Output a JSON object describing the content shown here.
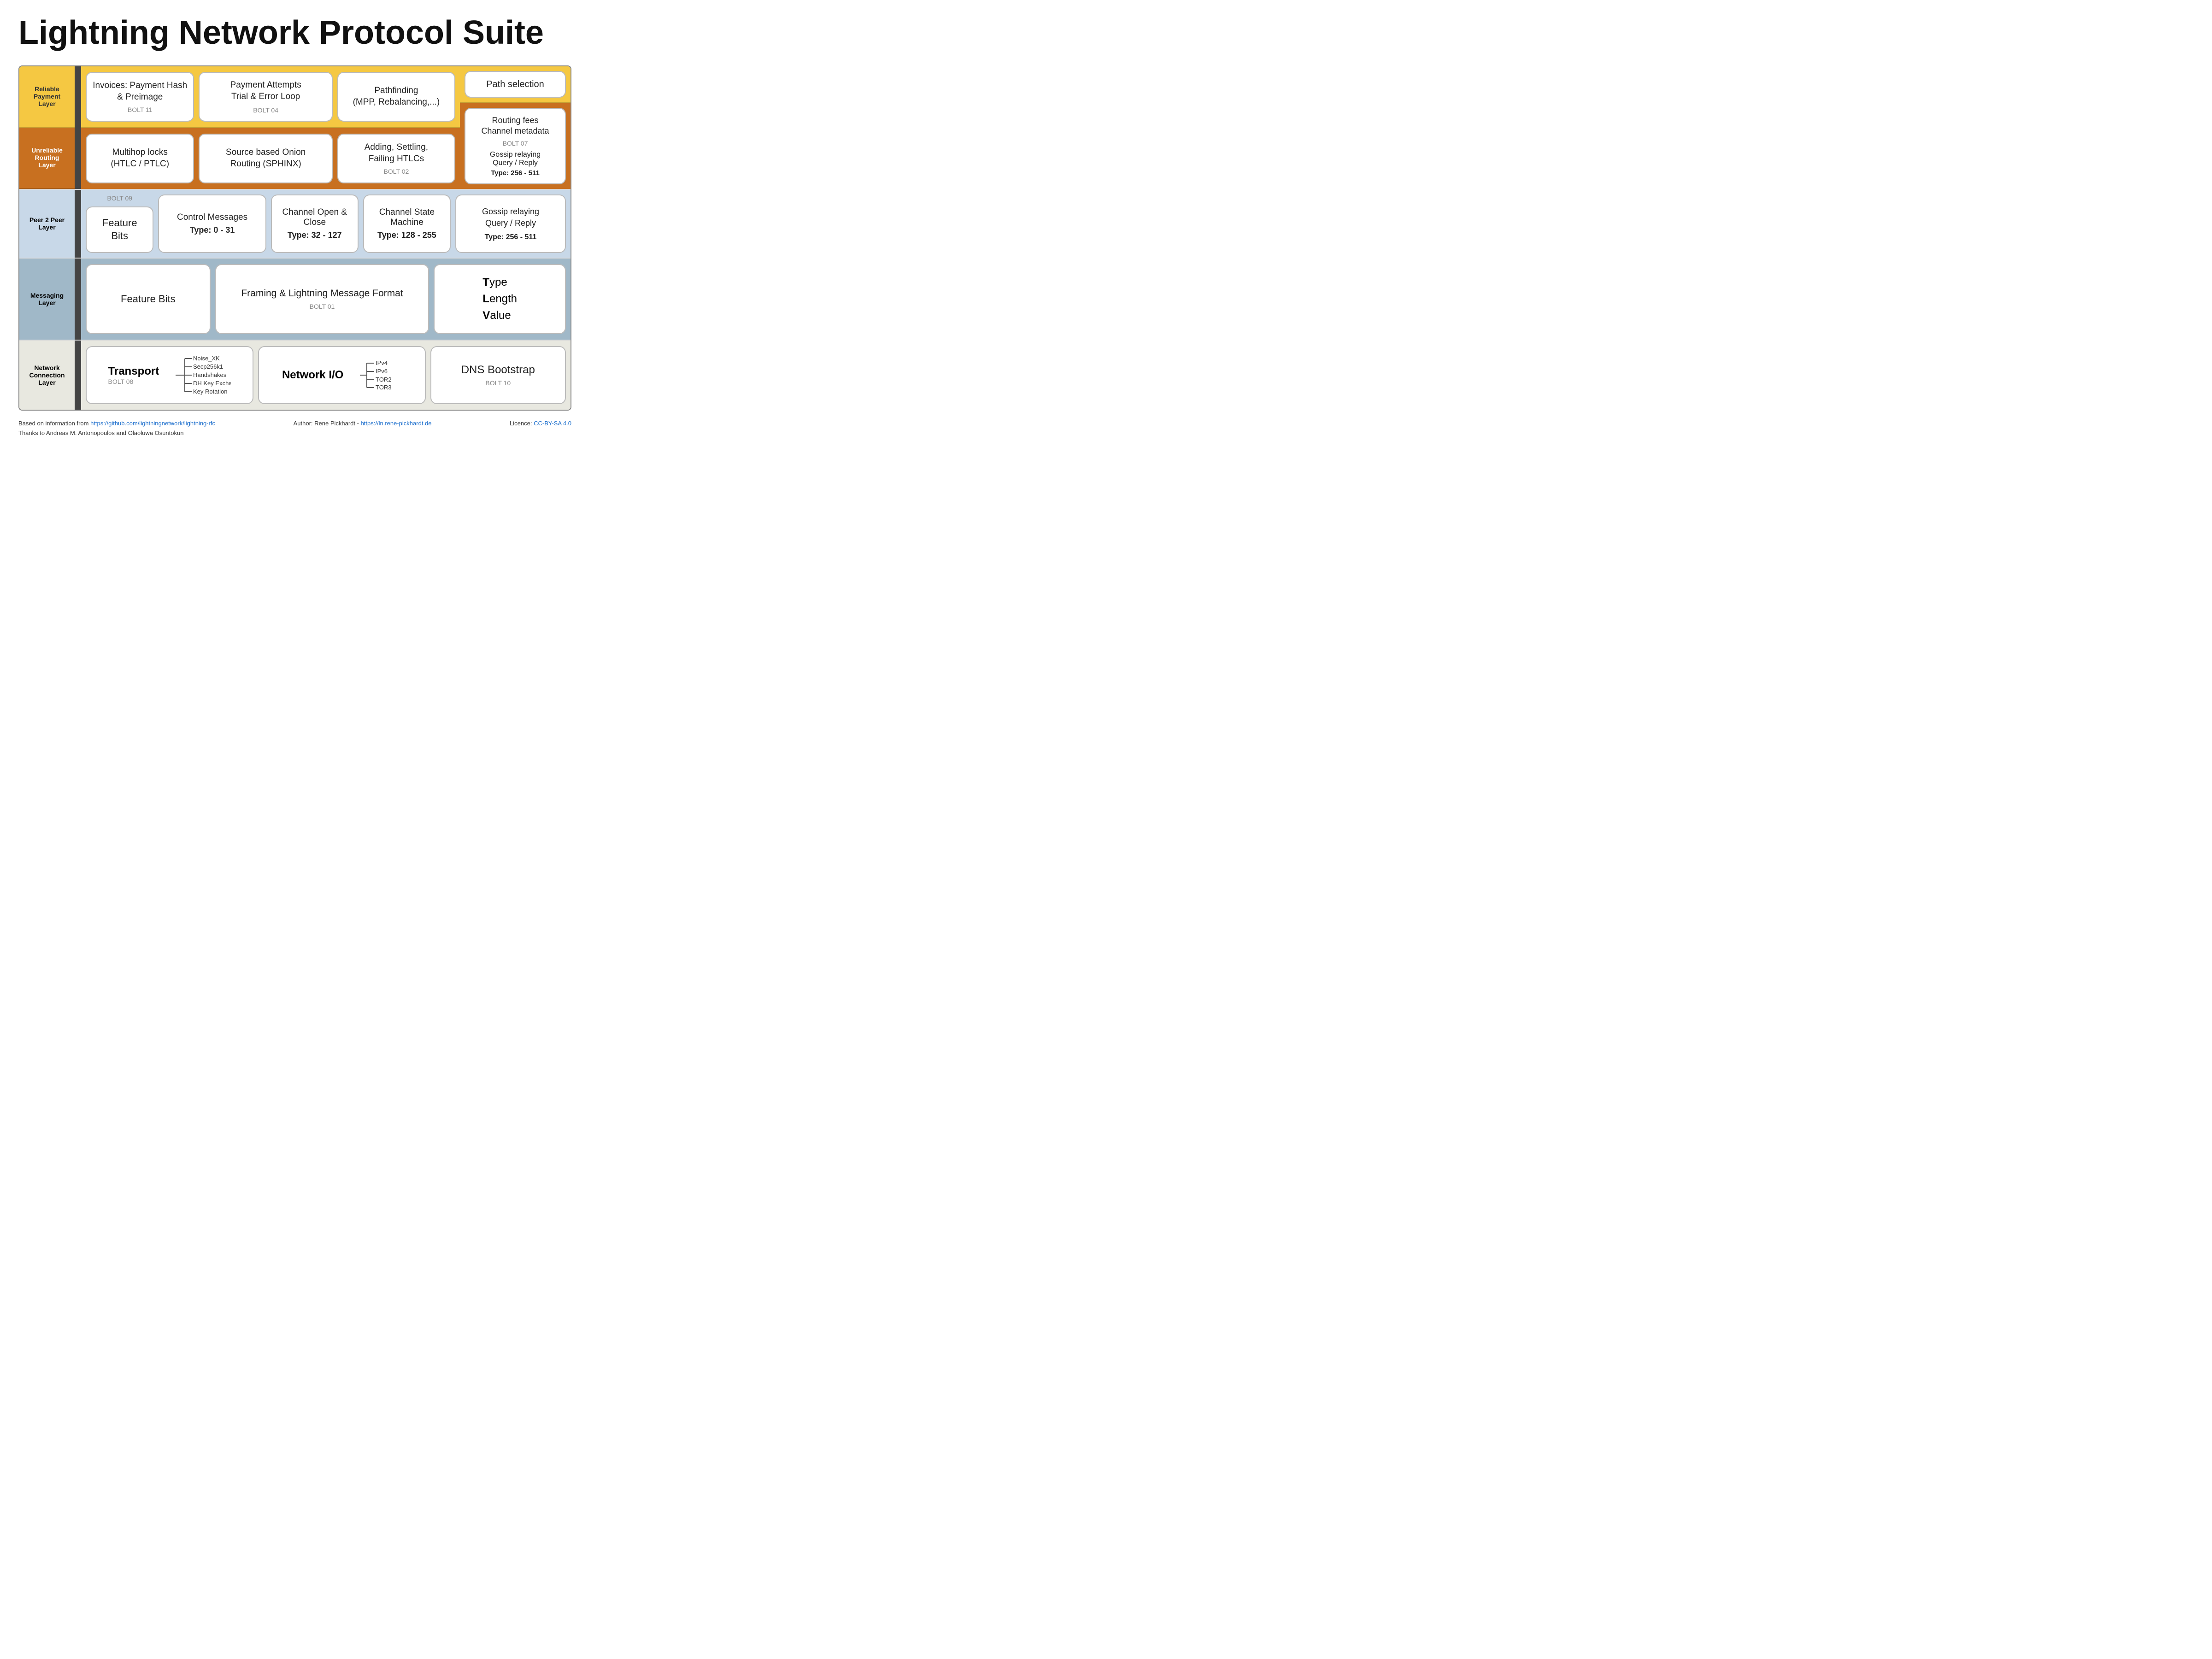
{
  "title": "Lightning Network Protocol Suite",
  "layers": {
    "reliable": {
      "label": "Reliable\nPayment\nLayer",
      "bgColor": "#f5c842"
    },
    "unreliable": {
      "label": "Unreliable\nRouting\nLayer",
      "bgColor": "#c87020"
    },
    "p2p": {
      "label": "Peer 2 Peer\nLayer",
      "bgColor": "#c8d8e8"
    },
    "messaging": {
      "label": "Messaging\nLayer",
      "bgColor": "#a0b8c8"
    },
    "network": {
      "label": "Network\nConnection\nLayer",
      "bgColor": "#e8e8e0"
    }
  },
  "cards": {
    "invoices": {
      "title": "Invoices: Payment\nHash & Preimage",
      "sub": "BOLT 11"
    },
    "payment_attempts": {
      "title": "Payment Attempts\nTrial & Error Loop",
      "bolt": "BOLT 04",
      "sub_title": "Source based Onion\nRouting (SPHINX)"
    },
    "pathfinding": {
      "title": "Pathfinding\n(MPP, Rebalancing,...)"
    },
    "path_selection": {
      "title": "Path selection"
    },
    "multihop": {
      "title": "Multihop locks\n(HTLC / PTLC)"
    },
    "adding_settling": {
      "title": "Adding, Settling,\nFailing HTLCs",
      "sub": "BOLT 02"
    },
    "routing_fees": {
      "title": "Routing fees\nChannel metadata",
      "sub": "BOLT 07",
      "sub2": "Gossip relaying\nQuery / Reply",
      "type_label": "Type: 256 - 511"
    },
    "control_messages": {
      "title": "Control Messages",
      "type": "Type: 0 - 31"
    },
    "channel_open": {
      "title": "Channel Open & Close",
      "type": "Type: 32 - 127"
    },
    "channel_state": {
      "title": "Channel State Machine",
      "type": "Type: 128 - 255"
    },
    "bolt09": "BOLT 09",
    "feature_bits": {
      "title": "Feature Bits"
    },
    "framing": {
      "title": "Framing & Lightning Message Format",
      "sub": "BOLT 01"
    },
    "tlv": {
      "title_t": "T",
      "title_l": "L",
      "title_v": "V",
      "title_bold_t": "T",
      "title_bold_l": "L",
      "title_bold_v": "V",
      "label": "Type\nLength\nValue"
    },
    "transport": {
      "title": "Transport",
      "sub": "BOLT 08",
      "items": [
        "Noise_XK",
        "Secp256k1",
        "Handshakes",
        "DH Key Exchange",
        "Key Rotation"
      ]
    },
    "network_io": {
      "title": "Network I/O",
      "items": [
        "IPv4",
        "IPv6",
        "TOR2",
        "TOR3"
      ]
    },
    "dns_bootstrap": {
      "title": "DNS Bootstrap",
      "sub": "BOLT 10"
    }
  },
  "footer": {
    "left_text": "Based on information from ",
    "left_link": "https://github.com/lightningnetwork/lightning-rfc",
    "left_link_label": "https://github.com/lightningnetwork/lightning-rfc",
    "center_text": "Author: Rene Pickhardt - ",
    "center_link": "https://ln.rene-pickhardt.de",
    "center_link_label": "https://ln.rene-pickhardt.de",
    "right_text": "Licence: ",
    "right_link": "CC-BY-SA 4.0",
    "thanks": "Thanks to Andreas M. Antonopoulos and Olaoluwa Osuntokun"
  }
}
